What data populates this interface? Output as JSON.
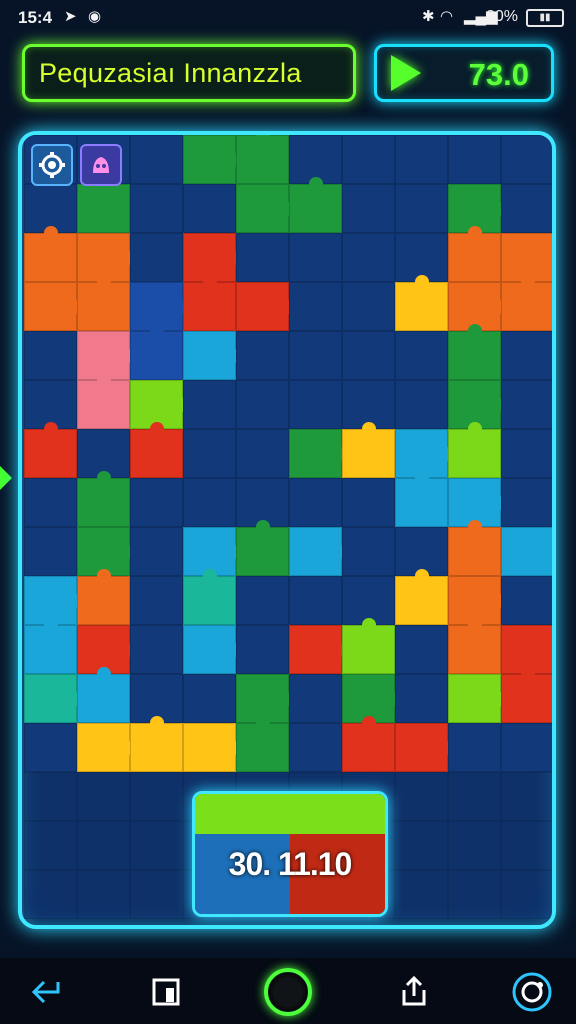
{
  "status": {
    "time": "15:4",
    "battery_text": "20%",
    "icons": [
      "navigation-icon",
      "notification-icon",
      "bluetooth-icon",
      "wifi-icon",
      "signal-icon",
      "battery-icon"
    ]
  },
  "header": {
    "title": "Pequzasiaı Innanzzla",
    "score": "73.0",
    "title_color": "#d8ff2e",
    "title_border": "#6bff2e",
    "score_border": "#19e0ff",
    "score_color": "#5cff3a"
  },
  "board": {
    "frame_color": "#3fe8ff",
    "background": "#0c2856",
    "tools": [
      "settings-icon",
      "hint-icon"
    ]
  },
  "counter": {
    "value": "30. 11.10"
  },
  "nav": {
    "items": [
      "back-icon",
      "recent-apps-icon",
      "home-button",
      "share-icon",
      "refresh-icon"
    ]
  },
  "colors": {
    "red": "#e0321c",
    "orange": "#f06a1e",
    "yellow": "#ffc416",
    "green": "#1e9a3c",
    "light_green": "#7bd91a",
    "blue": "#1a4ea8",
    "cyan": "#1aa6d8",
    "teal": "#1ab79a",
    "pink": "#f07a8c",
    "navy": "#123a7a"
  }
}
